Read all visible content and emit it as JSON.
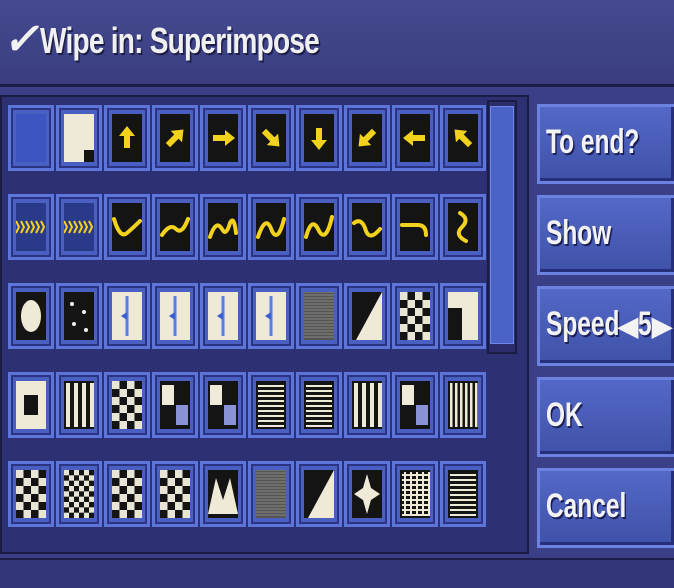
{
  "title": "Wipe in: Superimpose",
  "buttons": {
    "to_end": "To end?",
    "show": "Show",
    "speed_label": "Speed",
    "speed_value": "5",
    "ok": "OK",
    "cancel": "Cancel"
  },
  "icons": {
    "title_check": "checkmark-icon",
    "speed_decrease": "triangle-left-icon",
    "speed_increase": "triangle-right-icon"
  },
  "colors": {
    "arrow_yellow": "#f2d21c",
    "panel_blue": "#4a5fc2",
    "window_blue": "#3b3f88"
  },
  "wipe_grid": [
    [
      "plain",
      "corner-notch",
      "arrow-up",
      "arrow-up-right",
      "arrow-right",
      "arrow-down-right",
      "arrow-down",
      "arrow-down-left",
      "arrow-left",
      "arrow-up-left"
    ],
    [
      "zigzag-left",
      "zigzag-right",
      "wave-u",
      "wave-curl",
      "wave-loop",
      "wave-n",
      "wave-m",
      "wave-hook",
      "wave-bend",
      "wave-s"
    ],
    [
      "oval",
      "dots",
      "split-left",
      "split-right",
      "split-v",
      "split-h",
      "noise",
      "diagonal",
      "checker",
      "step"
    ],
    [
      "box",
      "bars",
      "checker-fade",
      "corner-fade",
      "staggered",
      "lines-h",
      "lines-offset",
      "bars-wide",
      "blocks",
      "stripes"
    ],
    [
      "circle-checker",
      "checker-fine",
      "checker-med",
      "checker-grid",
      "peaks",
      "noise-fine",
      "diagonal-split",
      "star",
      "grid-lines",
      "lines-fine"
    ]
  ]
}
